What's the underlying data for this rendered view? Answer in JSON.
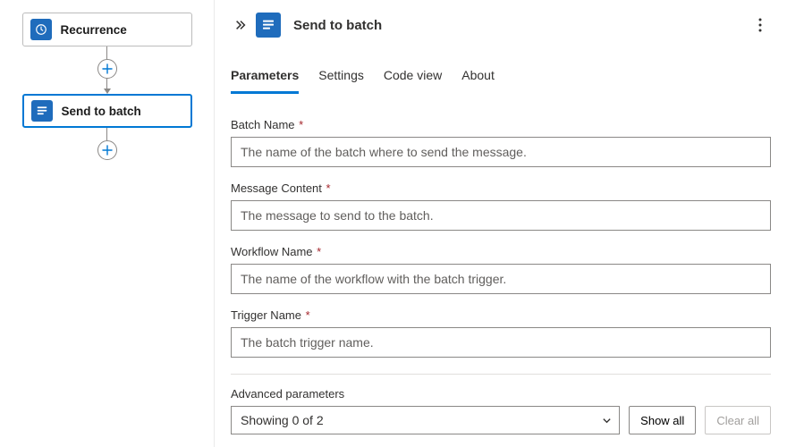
{
  "canvas": {
    "nodes": [
      {
        "label": "Recurrence",
        "icon": "clock",
        "selected": false
      },
      {
        "label": "Send to batch",
        "icon": "batch",
        "selected": true
      }
    ]
  },
  "panel": {
    "title": "Send to batch",
    "tabs": [
      {
        "label": "Parameters",
        "active": true
      },
      {
        "label": "Settings",
        "active": false
      },
      {
        "label": "Code view",
        "active": false
      },
      {
        "label": "About",
        "active": false
      }
    ],
    "fields": [
      {
        "label": "Batch Name",
        "required": true,
        "placeholder": "The name of the batch where to send the message."
      },
      {
        "label": "Message Content",
        "required": true,
        "placeholder": "The message to send to the batch."
      },
      {
        "label": "Workflow Name",
        "required": true,
        "placeholder": "The name of the workflow with the batch trigger."
      },
      {
        "label": "Trigger Name",
        "required": true,
        "placeholder": "The batch trigger name."
      }
    ],
    "advanced": {
      "label": "Advanced parameters",
      "select_text": "Showing 0 of 2",
      "show_all": "Show all",
      "clear_all": "Clear all",
      "clear_all_disabled": true
    }
  }
}
